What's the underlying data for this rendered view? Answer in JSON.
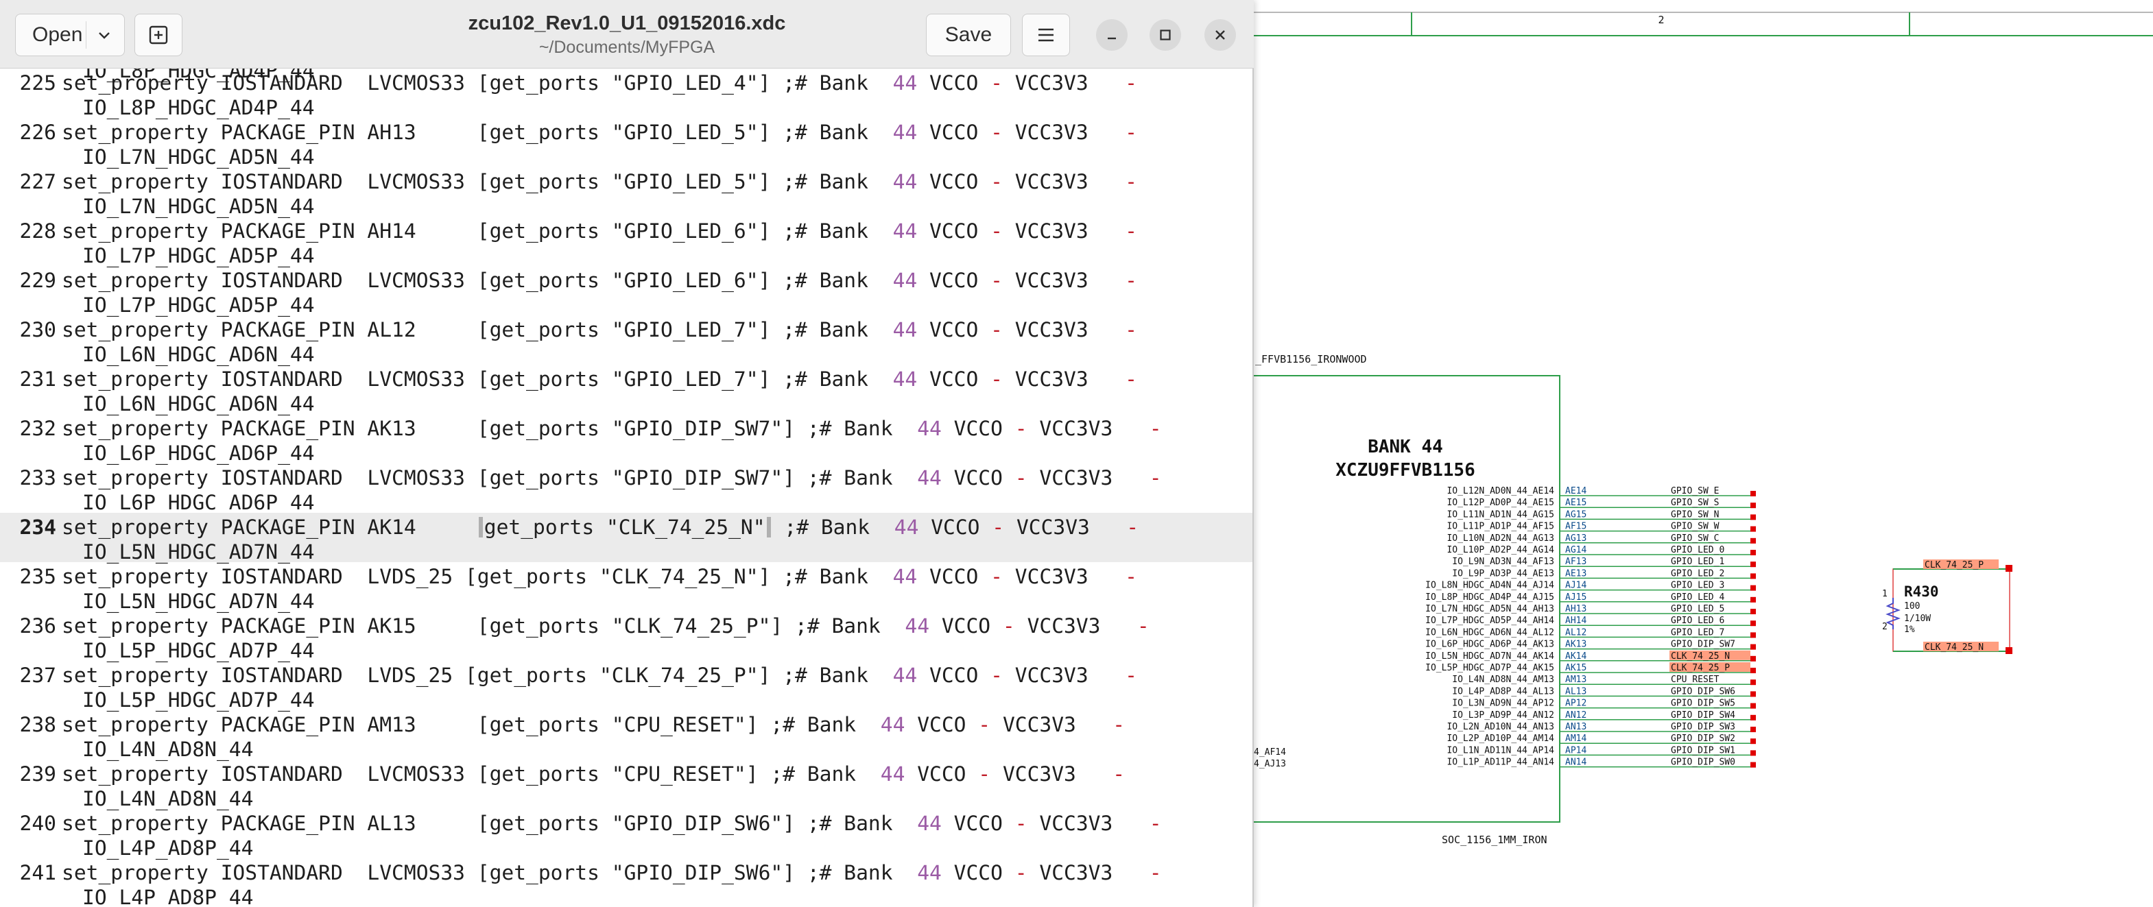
{
  "window": {
    "title": "zcu102_Rev1.0_U1_09152016.xdc",
    "subtitle": "~/Documents/MyFPGA",
    "open_label": "Open",
    "save_label": "Save",
    "icons": [
      "new-tab-icon",
      "hamburger-menu-icon",
      "minimize-icon",
      "maximize-icon",
      "close-icon",
      "chevron-down-icon"
    ]
  },
  "editor": {
    "top_partial": "IO_L8P_HDGC_AD4P_44",
    "current_line": "234",
    "lines": [
      {
        "num": "225",
        "code": "set_property IOSTANDARD  LVCMOS33 [get_ports \"GPIO_LED_4\"] ;# Bank  ",
        "bank": "44",
        "mid": " VCCO ",
        "dash": "-",
        "tail": " VCC3V3   ",
        "dash2": "-",
        "cont": "IO_L8P_HDGC_AD4P_44"
      },
      {
        "num": "226",
        "code": "set_property PACKAGE_PIN AH13     [get_ports \"GPIO_LED_5\"] ;# Bank  ",
        "bank": "44",
        "mid": " VCCO ",
        "dash": "-",
        "tail": " VCC3V3   ",
        "dash2": "-",
        "cont": "IO_L7N_HDGC_AD5N_44"
      },
      {
        "num": "227",
        "code": "set_property IOSTANDARD  LVCMOS33 [get_ports \"GPIO_LED_5\"] ;# Bank  ",
        "bank": "44",
        "mid": " VCCO ",
        "dash": "-",
        "tail": " VCC3V3   ",
        "dash2": "-",
        "cont": "IO_L7N_HDGC_AD5N_44"
      },
      {
        "num": "228",
        "code": "set_property PACKAGE_PIN AH14     [get_ports \"GPIO_LED_6\"] ;# Bank  ",
        "bank": "44",
        "mid": " VCCO ",
        "dash": "-",
        "tail": " VCC3V3   ",
        "dash2": "-",
        "cont": "IO_L7P_HDGC_AD5P_44"
      },
      {
        "num": "229",
        "code": "set_property IOSTANDARD  LVCMOS33 [get_ports \"GPIO_LED_6\"] ;# Bank  ",
        "bank": "44",
        "mid": " VCCO ",
        "dash": "-",
        "tail": " VCC3V3   ",
        "dash2": "-",
        "cont": "IO_L7P_HDGC_AD5P_44"
      },
      {
        "num": "230",
        "code": "set_property PACKAGE_PIN AL12     [get_ports \"GPIO_LED_7\"] ;# Bank  ",
        "bank": "44",
        "mid": " VCCO ",
        "dash": "-",
        "tail": " VCC3V3   ",
        "dash2": "-",
        "cont": "IO_L6N_HDGC_AD6N_44"
      },
      {
        "num": "231",
        "code": "set_property IOSTANDARD  LVCMOS33 [get_ports \"GPIO_LED_7\"] ;# Bank  ",
        "bank": "44",
        "mid": " VCCO ",
        "dash": "-",
        "tail": " VCC3V3   ",
        "dash2": "-",
        "cont": "IO_L6N_HDGC_AD6N_44"
      },
      {
        "num": "232",
        "code": "set_property PACKAGE_PIN AK13     [get_ports \"GPIO_DIP_SW7\"] ;# Bank  ",
        "bank": "44",
        "mid": " VCCO ",
        "dash": "-",
        "tail": " VCC3V3   ",
        "dash2": "-",
        "cont": "IO_L6P_HDGC_AD6P_44"
      },
      {
        "num": "233",
        "code": "set_property IOSTANDARD  LVCMOS33 [get_ports \"GPIO_DIP_SW7\"] ;# Bank  ",
        "bank": "44",
        "mid": " VCCO ",
        "dash": "-",
        "tail": " VCC3V3   ",
        "dash2": "-",
        "cont": "IO_L6P_HDGC_AD6P_44"
      },
      {
        "num": "234",
        "code_pre": "set_property PACKAGE_PIN AK14     ",
        "code_mid": "get_ports \"CLK_74_25_N\"",
        "code_post": " ;# Bank  ",
        "bank": "44",
        "mid": " VCCO ",
        "dash": "-",
        "tail": " VCC3V3   ",
        "dash2": "-",
        "cont": "IO_L5N_HDGC_AD7N_44"
      },
      {
        "num": "235",
        "code": "set_property IOSTANDARD  LVDS_25 [get_ports \"CLK_74_25_N\"] ;# Bank  ",
        "bank": "44",
        "mid": " VCCO ",
        "dash": "-",
        "tail": " VCC3V3   ",
        "dash2": "-",
        "cont": "IO_L5N_HDGC_AD7N_44"
      },
      {
        "num": "236",
        "code": "set_property PACKAGE_PIN AK15     [get_ports \"CLK_74_25_P\"] ;# Bank  ",
        "bank": "44",
        "mid": " VCCO ",
        "dash": "-",
        "tail": " VCC3V3   ",
        "dash2": "-",
        "cont": "IO_L5P_HDGC_AD7P_44"
      },
      {
        "num": "237",
        "code": "set_property IOSTANDARD  LVDS_25 [get_ports \"CLK_74_25_P\"] ;# Bank  ",
        "bank": "44",
        "mid": " VCCO ",
        "dash": "-",
        "tail": " VCC3V3   ",
        "dash2": "-",
        "cont": "IO_L5P_HDGC_AD7P_44"
      },
      {
        "num": "238",
        "code": "set_property PACKAGE_PIN AM13     [get_ports \"CPU_RESET\"] ;# Bank  ",
        "bank": "44",
        "mid": " VCCO ",
        "dash": "-",
        "tail": " VCC3V3   ",
        "dash2": "-",
        "cont": "IO_L4N_AD8N_44"
      },
      {
        "num": "239",
        "code": "set_property IOSTANDARD  LVCMOS33 [get_ports \"CPU_RESET\"] ;# Bank  ",
        "bank": "44",
        "mid": " VCCO ",
        "dash": "-",
        "tail": " VCC3V3   ",
        "dash2": "-",
        "cont": "IO_L4N_AD8N_44"
      },
      {
        "num": "240",
        "code": "set_property PACKAGE_PIN AL13     [get_ports \"GPIO_DIP_SW6\"] ;# Bank  ",
        "bank": "44",
        "mid": " VCCO ",
        "dash": "-",
        "tail": " VCC3V3   ",
        "dash2": "-",
        "cont": "IO_L4P_AD8P_44"
      },
      {
        "num": "241",
        "code": "set_property IOSTANDARD  LVCMOS33 [get_ports \"GPIO_DIP_SW6\"] ;# Bank  ",
        "bank": "44",
        "mid": " VCCO ",
        "dash": "-",
        "tail": " VCC3V3   ",
        "dash2": "-",
        "cont": "IO_L4P_AD8P_44"
      }
    ]
  },
  "schematic": {
    "grid_label": "2",
    "part_label_partial": "_FFVB1156_IRONWOOD",
    "bank_title": "BANK 44",
    "bank_part": "XCZU9FFVB1156",
    "footer_label": "SOC_1156_1MM_IRON",
    "left_partial": [
      "4_AF14",
      "4_AJ13"
    ],
    "pins": [
      {
        "name": "IO_L12N_AD0N_44_AE14",
        "ball": "AE14",
        "net": "GPIO_SW_E"
      },
      {
        "name": "IO_L12P_AD0P_44_AE15",
        "ball": "AE15",
        "net": "GPIO_SW_S"
      },
      {
        "name": "IO_L11N_AD1N_44_AG15",
        "ball": "AG15",
        "net": "GPIO_SW_N"
      },
      {
        "name": "IO_L11P_AD1P_44_AF15",
        "ball": "AF15",
        "net": "GPIO_SW_W"
      },
      {
        "name": "IO_L10N_AD2N_44_AG13",
        "ball": "AG13",
        "net": "GPIO_SW_C"
      },
      {
        "name": "IO_L10P_AD2P_44_AG14",
        "ball": "AG14",
        "net": "GPIO_LED_0"
      },
      {
        "name": "IO_L9N_AD3N_44_AF13",
        "ball": "AF13",
        "net": "GPIO_LED_1"
      },
      {
        "name": "IO_L9P_AD3P_44_AE13",
        "ball": "AE13",
        "net": "GPIO_LED_2"
      },
      {
        "name": "IO_L8N_HDGC_AD4N_44_AJ14",
        "ball": "AJ14",
        "net": "GPIO_LED_3"
      },
      {
        "name": "IO_L8P_HDGC_AD4P_44_AJ15",
        "ball": "AJ15",
        "net": "GPIO_LED_4"
      },
      {
        "name": "IO_L7N_HDGC_AD5N_44_AH13",
        "ball": "AH13",
        "net": "GPIO_LED_5"
      },
      {
        "name": "IO_L7P_HDGC_AD5P_44_AH14",
        "ball": "AH14",
        "net": "GPIO_LED_6"
      },
      {
        "name": "IO_L6N_HDGC_AD6N_44_AL12",
        "ball": "AL12",
        "net": "GPIO_LED_7"
      },
      {
        "name": "IO_L6P_HDGC_AD6P_44_AK13",
        "ball": "AK13",
        "net": "GPIO_DIP_SW7"
      },
      {
        "name": "IO_L5N_HDGC_AD7N_44_AK14",
        "ball": "AK14",
        "net": "CLK_74_25_N"
      },
      {
        "name": "IO_L5P_HDGC_AD7P_44_AK15",
        "ball": "AK15",
        "net": "CLK_74_25_P"
      },
      {
        "name": "IO_L4N_AD8N_44_AM13",
        "ball": "AM13",
        "net": "CPU_RESET"
      },
      {
        "name": "IO_L4P_AD8P_44_AL13",
        "ball": "AL13",
        "net": "GPIO_DIP_SW6"
      },
      {
        "name": "IO_L3N_AD9N_44_AP12",
        "ball": "AP12",
        "net": "GPIO_DIP_SW5"
      },
      {
        "name": "IO_L3P_AD9P_44_AN12",
        "ball": "AN12",
        "net": "GPIO_DIP_SW4"
      },
      {
        "name": "IO_L2N_AD10N_44_AN13",
        "ball": "AN13",
        "net": "GPIO_DIP_SW3"
      },
      {
        "name": "IO_L2P_AD10P_44_AM14",
        "ball": "AM14",
        "net": "GPIO_DIP_SW2"
      },
      {
        "name": "IO_L1N_AD11N_44_AP14",
        "ball": "AP14",
        "net": "GPIO_DIP_SW1"
      },
      {
        "name": "IO_L1P_AD11P_44_AN14",
        "ball": "AN14",
        "net": "GPIO_DIP_SW0"
      }
    ],
    "resistor": {
      "ref": "R430",
      "value": "100",
      "power": "1/10W",
      "tolerance": "1%",
      "pin1": "1",
      "pin2": "2",
      "net_top": "CLK_74_25_P",
      "net_bottom": "CLK_74_25_N"
    },
    "colors": {
      "wire": "#2e9e4a",
      "net_highlight": "#ff9e80",
      "port_red": "#e00000"
    }
  }
}
